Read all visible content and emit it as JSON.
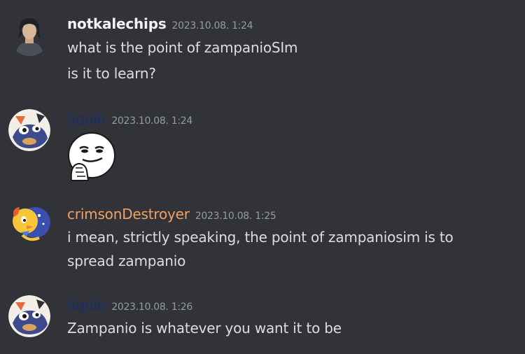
{
  "messages": [
    {
      "username": "notkalechips",
      "username_color": "#f2f3f5",
      "timestamp": "2023.10.08. 1:24",
      "lines": [
        "what is the point of zampanioSIm",
        "is it to learn?"
      ]
    },
    {
      "username": "Squib",
      "username_color": "#1a2d6b",
      "timestamp": "2023.10.08. 1:24",
      "emoji": "smirking-face-emoji"
    },
    {
      "username": "crimsonDestroyer",
      "username_color": "#f2a163",
      "timestamp": "2023.10.08. 1:25",
      "lines": [
        "i mean, strictly speaking, the point of zampaniosim is to",
        "spread zampanio"
      ]
    },
    {
      "username": "Squib",
      "username_color": "#1a2d6b",
      "timestamp": "2023.10.08. 1:26",
      "lines": [
        "Zampanio is whatever you want it to be"
      ]
    }
  ]
}
